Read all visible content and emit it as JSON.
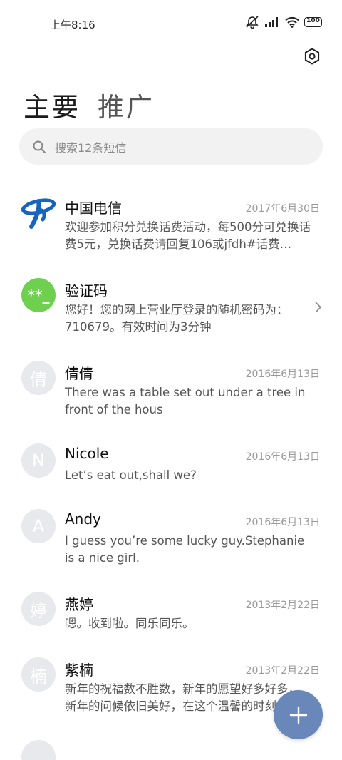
{
  "status_bar": {
    "time": "上午8:16",
    "battery": "100"
  },
  "tabs": [
    {
      "label": "主要",
      "active": true
    },
    {
      "label": "推广",
      "active": false
    }
  ],
  "search": {
    "placeholder": "搜索12条短信"
  },
  "conversations": [
    {
      "name": "中国电信",
      "date": "2017年6月30日",
      "preview": "欢迎参加积分兑换话费活动，每500分可兑换话费5元，兑换话费请回复106或jfdh#话费…",
      "avatar": "china-telecom-logo"
    },
    {
      "name": "验证码",
      "date": "",
      "preview": "您好！您的网上营业厅登录的随机密码为：710679。有效时间为3分钟",
      "avatar": "**_"
    },
    {
      "name": "倩倩",
      "date": "2016年6月13日",
      "preview": "There was a table set out under a tree in front of the hous",
      "avatar": "倩"
    },
    {
      "name": "Nicole",
      "date": "2016年6月13日",
      "preview": "Let’s eat out,shall we?",
      "avatar": "N"
    },
    {
      "name": "Andy",
      "date": "2016年6月13日",
      "preview": "I guess you’re some lucky guy.Stephanie is a nice girl.",
      "avatar": "A"
    },
    {
      "name": "燕婷",
      "date": "2013年2月22日",
      "preview": "嗯。收到啦。同乐同乐。",
      "avatar": "婷"
    },
    {
      "name": "紫楠",
      "date": "2013年2月22日",
      "preview": "新年的祝福数不胜数，新年的愿望好多好多，新年的问候依旧美好，在这个温馨的时刻",
      "avatar": "楠"
    }
  ],
  "colors": {
    "fab": "#6a87b9",
    "verify_avatar": "#6fcf4f",
    "telecom_blue": "#1565c0"
  }
}
